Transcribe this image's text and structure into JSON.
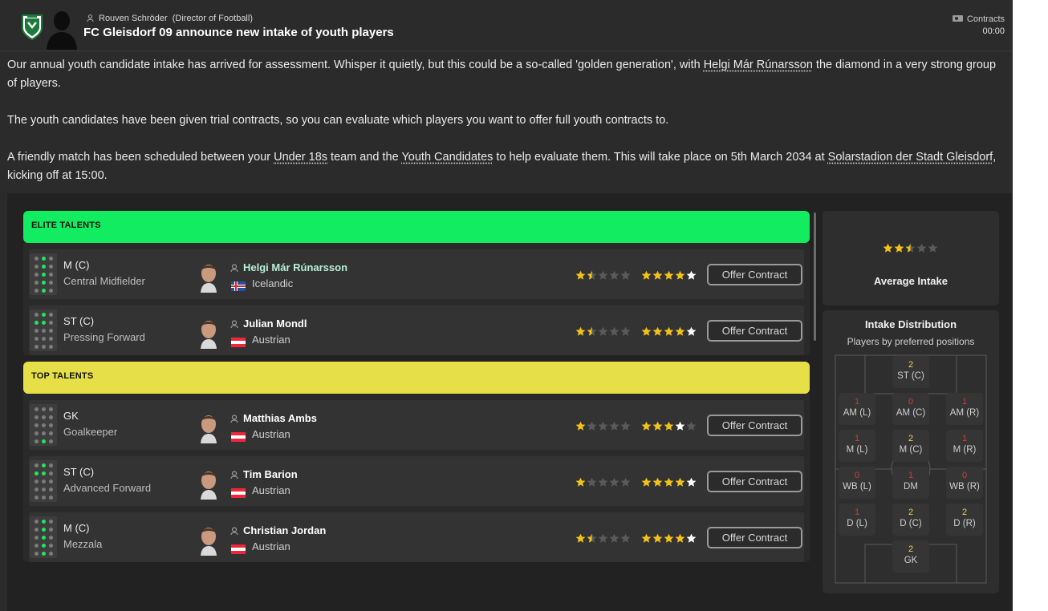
{
  "header": {
    "sender_name": "Rouven Schröder",
    "sender_role": "(Director of Football)",
    "title": "FC Gleisdorf 09 announce new intake of youth players",
    "category": "Contracts",
    "time": "00:00"
  },
  "article": {
    "p1_a": "Our annual youth candidate intake has arrived for assessment. Whisper it quietly, but this could be a so-called 'golden generation', with ",
    "p1_link": "Helgi Már Rúnarsson",
    "p1_b": " the diamond in a very strong group of players.",
    "p2": "The youth candidates have been given trial contracts, so you can evaluate which players you want to offer full youth contracts to.",
    "p3_a": "A friendly match has been scheduled between your ",
    "p3_link1": "Under 18s",
    "p3_b": " team and the ",
    "p3_link2": "Youth Candidates",
    "p3_c": " to help evaluate them. This will take place on 5th March 2034 at ",
    "p3_link3": "Solarstadion der Stadt Gleisdorf",
    "p3_d": ", kicking off at 15:00."
  },
  "sections": [
    {
      "title": "ELITE TALENTS",
      "color": "#12ec60",
      "players": [
        {
          "pos": "M (C)",
          "role": "Central Midfielder",
          "name": "Helgi Már Rúnarsson",
          "nation": "Icelandic",
          "flag": "iceland",
          "ca": 1.5,
          "pa": 4.5,
          "button": "Offer Contract",
          "interested": true
        },
        {
          "pos": "ST (C)",
          "role": "Pressing Forward",
          "name": "Julian Mondl",
          "nation": "Austrian",
          "flag": "austria",
          "ca": 1.5,
          "pa": 4.5,
          "button": "Offer Contract",
          "interested": false
        }
      ]
    },
    {
      "title": "TOP TALENTS",
      "color": "#e7df48",
      "players": [
        {
          "pos": "GK",
          "role": "Goalkeeper",
          "name": "Matthias Ambs",
          "nation": "Austrian",
          "flag": "austria",
          "ca": 1,
          "pa": 3.5,
          "button": "Offer Contract",
          "interested": false
        },
        {
          "pos": "ST (C)",
          "role": "Advanced Forward",
          "name": "Tim Barion",
          "nation": "Austrian",
          "flag": "austria",
          "ca": 1,
          "pa": 4.5,
          "button": "Offer Contract",
          "interested": false
        },
        {
          "pos": "M (C)",
          "role": "Mezzala",
          "name": "Christian Jordan",
          "nation": "Austrian",
          "flag": "austria",
          "ca": 1.5,
          "pa": 4.5,
          "button": "Offer Contract",
          "interested": false
        }
      ]
    }
  ],
  "average": {
    "label": "Average Intake",
    "stars": 2.5
  },
  "distribution": {
    "title": "Intake Distribution",
    "subtitle": "Players by preferred positions",
    "positions": [
      {
        "label": "ST (C)",
        "count": "2"
      },
      {
        "label": "AM (L)",
        "count": "1"
      },
      {
        "label": "AM (C)",
        "count": "0"
      },
      {
        "label": "AM (R)",
        "count": "1"
      },
      {
        "label": "M (L)",
        "count": "1"
      },
      {
        "label": "M (C)",
        "count": "2"
      },
      {
        "label": "M (R)",
        "count": "1"
      },
      {
        "label": "WB (L)",
        "count": "0"
      },
      {
        "label": "DM",
        "count": "1"
      },
      {
        "label": "WB (R)",
        "count": "0"
      },
      {
        "label": "D (L)",
        "count": "1"
      },
      {
        "label": "D (C)",
        "count": "2"
      },
      {
        "label": "D (R)",
        "count": "2"
      },
      {
        "label": "GK",
        "count": "2"
      }
    ]
  },
  "colors": {
    "star_gold": "#f2c21b",
    "star_white": "#ffffff",
    "star_empty": "#5a5a5a",
    "elite": "#12ec60",
    "top": "#e7df48"
  }
}
